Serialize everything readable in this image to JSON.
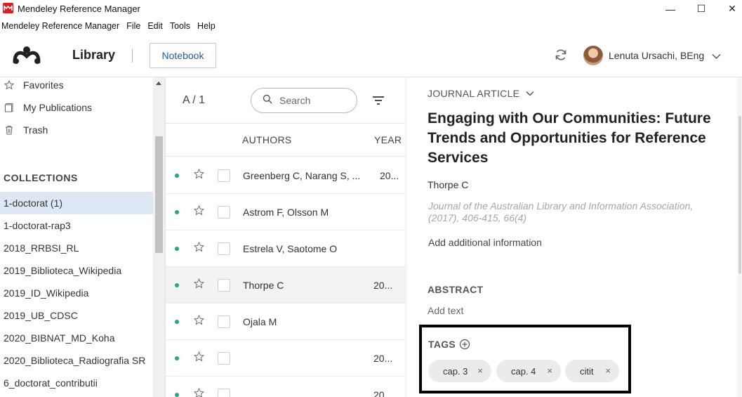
{
  "window": {
    "title": "Mendeley Reference Manager",
    "controls": {
      "minimize": "—",
      "maximize": "☐",
      "close": "✕"
    }
  },
  "menubar": [
    "Mendeley Reference Manager",
    "File",
    "Edit",
    "Tools",
    "Help"
  ],
  "header": {
    "library_label": "Library",
    "notebook_label": "Notebook",
    "user_name": "Lenuta Ursachi, BEng",
    "icons": [
      "mendeley-logo-icon",
      "sync-icon",
      "avatar",
      "chevron-down-icon"
    ]
  },
  "sidebar": {
    "items": [
      {
        "label": "Favorites",
        "icon": "star-icon"
      },
      {
        "label": "My Publications",
        "icon": "publications-icon"
      },
      {
        "label": "Trash",
        "icon": "trash-icon"
      }
    ],
    "collections_heading": "COLLECTIONS",
    "collections": [
      "1-doctorat (1)",
      "1-doctorat-rap3",
      "2018_RRBSI_RL",
      "2019_Biblioteca_Wikipedia",
      "2019_ID_Wikipedia",
      "2019_UB_CDSC",
      "2020_BIBNAT_MD_Koha",
      "2020_Biblioteca_Radiografia SR",
      "6_doctorat_contributii"
    ],
    "selected_collection": "1-doctorat (1)"
  },
  "list": {
    "sort_label": "A / 1",
    "search_placeholder": "Search",
    "columns": {
      "authors": "AUTHORS",
      "year": "YEAR"
    },
    "rows": [
      {
        "authors": "Greenberg C, Narang S, ...",
        "year": "20..."
      },
      {
        "authors": "Astrom F, Olsson M",
        "year": ""
      },
      {
        "authors": "Estrela V, Saotome O",
        "year": ""
      },
      {
        "authors": "Thorpe C",
        "year": "20..."
      },
      {
        "authors": "Ojala M",
        "year": ""
      },
      {
        "authors": "",
        "year": "20..."
      },
      {
        "authors": "",
        "year": "20"
      }
    ]
  },
  "details": {
    "type_label": "JOURNAL ARTICLE",
    "title": "Engaging with Our Communities: Future Trends and Opportunities for Reference Services",
    "authors": "Thorpe C",
    "journal": "Journal of the Australian Library and Information Association, (2017), 406-415, 66(4)",
    "add_info": "Add additional information",
    "abstract_heading": "ABSTRACT",
    "abstract_placeholder": "Add text",
    "tags_heading": "TAGS",
    "tags": [
      "cap. 3",
      "cap. 4",
      "citit"
    ],
    "tag_remove": "×"
  },
  "colors": {
    "accent_blue": "#1f5d95",
    "selected_bg": "#dde8f5",
    "unread_dot": "#2aa67d",
    "brand_red": "#d71e27"
  }
}
